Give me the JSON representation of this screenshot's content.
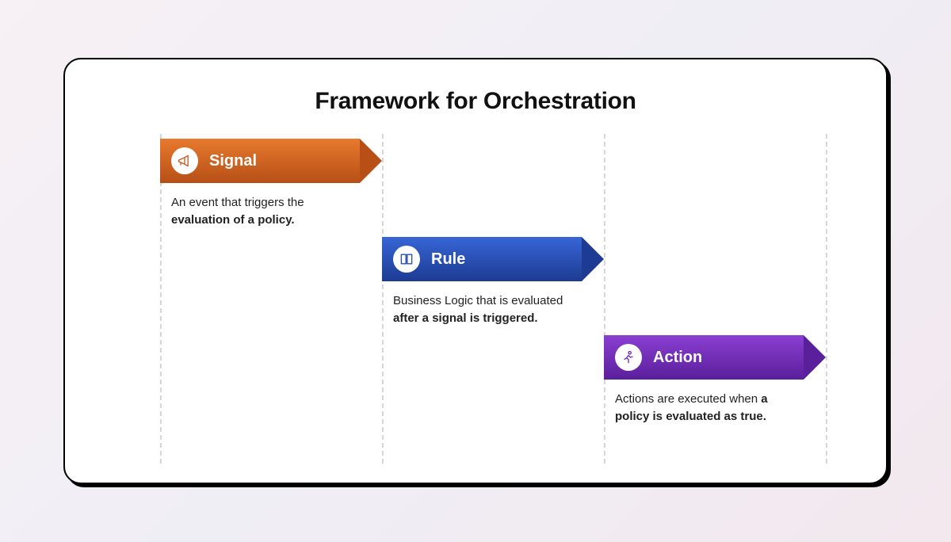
{
  "title": "Framework for Orchestration",
  "steps": {
    "signal": {
      "label": "Signal",
      "desc_a": "An event that triggers the ",
      "desc_b": "evaluation of a policy.",
      "icon": "megaphone-icon"
    },
    "rule": {
      "label": "Rule",
      "desc_a": "Business Logic that is evaluated ",
      "desc_b": "after a signal is triggered.",
      "icon": "book-icon"
    },
    "action": {
      "label": "Action",
      "desc_a": "Actions are executed when ",
      "desc_b": "a policy is evaluated as true.",
      "icon": "running-person-icon"
    }
  },
  "colors": {
    "signal": "#c75a1e",
    "rule": "#2a4fb0",
    "action": "#6f2ab8"
  }
}
